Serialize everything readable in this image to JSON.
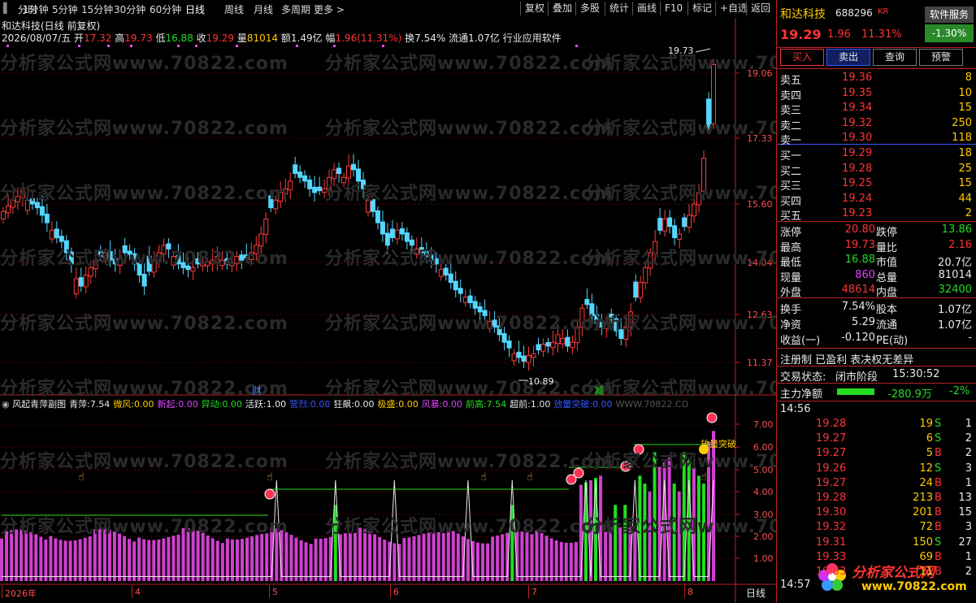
{
  "menu": {
    "left_items": [
      "分时",
      "1分钟",
      "5分钟",
      "15分钟",
      "30分钟",
      "60分钟",
      "日线",
      "周线",
      "月线",
      "多周期",
      "更多"
    ],
    "active": "日线",
    "right_items": [
      "复权",
      "叠加",
      "多股",
      "统计",
      "画线",
      "F10",
      "标记",
      "+自选",
      "返回"
    ]
  },
  "stock_header": {
    "title": "和达科技(日线 前复权)",
    "date": "2026/08/07/五",
    "open_label": "开",
    "open": "17.32",
    "high_label": "高",
    "high": "19.73",
    "low_label": "低",
    "low": "16.88",
    "close_label": "收",
    "close": "19.29",
    "vol_label": "量",
    "vol": "81014",
    "amount_label": "额",
    "amount": "1.49亿",
    "chg_label": "幅",
    "chg": "1.96(11.31%)",
    "turnover_label": "换",
    "turnover": "7.54%",
    "float_label": "流通",
    "float": "1.07亿",
    "industry": "行业应用软件"
  },
  "price_axis": [
    "19.06",
    "17.33",
    "15.60",
    "14.04",
    "12.63",
    "11.37"
  ],
  "price_markers": {
    "high": "19.73",
    "low": "10.89"
  },
  "chart_tags": {
    "cai": "财",
    "jian": "减"
  },
  "indicator": {
    "name": "风起青萍副图",
    "items": [
      {
        "label": "青萍:",
        "value": "7.54",
        "color": "#e8e8e8"
      },
      {
        "label": "微风:",
        "value": "0.00",
        "color": "#ffcc00"
      },
      {
        "label": "新起:",
        "value": "0.00",
        "color": "#dd44ff"
      },
      {
        "label": "异动:",
        "value": "0.00",
        "color": "#22dd22"
      },
      {
        "label": "活跃:",
        "value": "1.00",
        "color": "#e8e8e8"
      },
      {
        "label": "营烈:",
        "value": "0.00",
        "color": "#3355ff"
      },
      {
        "label": "狂飙:",
        "value": "0.00",
        "color": "#e8e8e8"
      },
      {
        "label": "极盛:",
        "value": "0.00",
        "color": "#ffcc00"
      },
      {
        "label": "风暴:",
        "value": "0.00",
        "color": "#dd44ff"
      },
      {
        "label": "前高:",
        "value": "7.54",
        "color": "#22dd22"
      },
      {
        "label": "超前:",
        "value": "1.00",
        "color": "#e8e8e8"
      },
      {
        "label": "放量突破:",
        "value": "0.00",
        "color": "#3355ff"
      },
      {
        "label": "WWW.70822.CO",
        "value": "",
        "color": "#555555"
      }
    ],
    "axis": [
      "7.00",
      "6.00",
      "5.00",
      "4.00",
      "3.00",
      "2.00",
      "1.00"
    ],
    "annotation": "放量突破"
  },
  "date_axis": [
    "2026年",
    "4",
    "5",
    "6",
    "7",
    "8"
  ],
  "date_axis_right": "日线",
  "watermark": "分析家公式网www.70822.com",
  "right_panel": {
    "name": "和达科技",
    "code": "688296",
    "market": "KR",
    "service_btn": "软件服务",
    "price": "19.29",
    "change": "1.96",
    "change_pct": "11.31%",
    "badge": "-1.30%",
    "actions": [
      "买入",
      "卖出",
      "查询",
      "预警"
    ],
    "asks": [
      {
        "label": "卖五",
        "price": "19.36",
        "vol": "8"
      },
      {
        "label": "卖四",
        "price": "19.35",
        "vol": "10"
      },
      {
        "label": "卖三",
        "price": "19.34",
        "vol": "15"
      },
      {
        "label": "卖二",
        "price": "19.32",
        "vol": "250"
      },
      {
        "label": "卖一",
        "price": "19.30",
        "vol": "118"
      }
    ],
    "bids": [
      {
        "label": "买一",
        "price": "19.29",
        "vol": "18"
      },
      {
        "label": "买二",
        "price": "19.28",
        "vol": "25"
      },
      {
        "label": "买三",
        "price": "19.25",
        "vol": "15"
      },
      {
        "label": "买四",
        "price": "19.24",
        "vol": "44"
      },
      {
        "label": "买五",
        "price": "19.23",
        "vol": "2"
      }
    ],
    "stats": [
      {
        "l1": "涨停",
        "v1": "20.80",
        "c1": "red",
        "l2": "跌停",
        "v2": "13.86",
        "c2": "green"
      },
      {
        "l1": "最高",
        "v1": "19.73",
        "c1": "red",
        "l2": "量比",
        "v2": "2.16",
        "c2": "red"
      },
      {
        "l1": "最低",
        "v1": "16.88",
        "c1": "green",
        "l2": "市值",
        "v2": "20.7亿",
        "c2": "white"
      },
      {
        "l1": "现量",
        "v1": "860",
        "c1": "magenta",
        "l2": "总量",
        "v2": "81014",
        "c2": "white"
      },
      {
        "l1": "外盘",
        "v1": "48614",
        "c1": "red",
        "l2": "内盘",
        "v2": "32400",
        "c2": "green"
      }
    ],
    "stats2": [
      {
        "l1": "换手",
        "v1": "7.54%",
        "l2": "股本",
        "v2": "1.07亿"
      },
      {
        "l1": "净资",
        "v1": "5.29",
        "l2": "流通",
        "v2": "1.07亿"
      },
      {
        "l1": "收益(一)",
        "v1": "-0.120",
        "l2": "PE(动)",
        "v2": "-"
      }
    ],
    "tags_line": "注册制 已盈利 表决权无差异",
    "trade_status_label": "交易状态:",
    "trade_status": "闭市阶段",
    "trade_time": "15:30:52",
    "main_flow_label": "主力净额",
    "main_flow": "-280.9万",
    "main_flow_pct": "-2%",
    "tick_time": "14:56",
    "ticks": [
      {
        "p": "19.28",
        "v": "19",
        "s": "S",
        "n": "1"
      },
      {
        "p": "19.27",
        "v": "6",
        "s": "S",
        "n": "2"
      },
      {
        "p": "19.27",
        "v": "5",
        "s": "B",
        "n": "2"
      },
      {
        "p": "19.26",
        "v": "12",
        "s": "S",
        "n": "3"
      },
      {
        "p": "19.27",
        "v": "24",
        "s": "B",
        "n": "1"
      },
      {
        "p": "19.28",
        "v": "213",
        "s": "B",
        "n": "13"
      },
      {
        "p": "19.30",
        "v": "201",
        "s": "B",
        "n": "15"
      },
      {
        "p": "19.32",
        "v": "72",
        "s": "B",
        "n": "3"
      },
      {
        "p": "19.31",
        "v": "150",
        "s": "S",
        "n": "27"
      },
      {
        "p": "19.33",
        "v": "69",
        "s": "B",
        "n": "1"
      },
      {
        "p": "19.33",
        "v": "11",
        "s": "B",
        "n": "2"
      }
    ],
    "tick_time2": "14:57",
    "logo_text": "分析家公式网",
    "logo_url": "www.70822.com"
  }
}
